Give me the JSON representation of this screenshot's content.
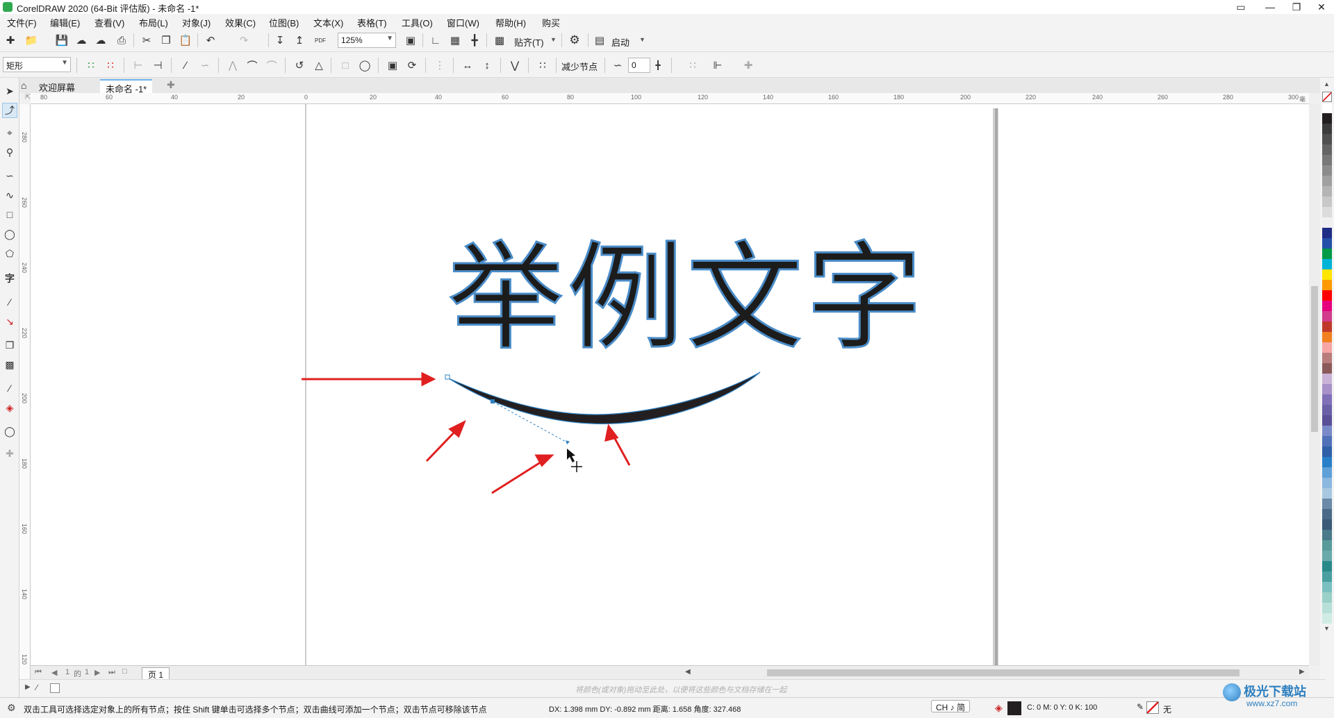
{
  "window": {
    "title": "CorelDRAW 2020 (64-Bit 评估版) - 未命名 -1*",
    "buttons": [
      "minimize",
      "maximize",
      "close"
    ]
  },
  "menu": [
    "文件(F)",
    "编辑(E)",
    "查看(V)",
    "布局(L)",
    "对象(J)",
    "效果(C)",
    "位图(B)",
    "文本(X)",
    "表格(T)",
    "工具(O)",
    "窗口(W)",
    "帮助(H)",
    "购买"
  ],
  "toolbar1": {
    "zoom_value": "125%",
    "snap_label": "贴齐(T)",
    "launch_label": "启动",
    "pdf_label": "PDF"
  },
  "toolbar2": {
    "shape_type": "矩形",
    "reduce_nodes_label": "减少节点",
    "smoothness_value": "0"
  },
  "tabs": {
    "welcome": "欢迎屏幕",
    "document": "未命名 -1*"
  },
  "ruler": {
    "h_labels": [
      "80",
      "60",
      "40",
      "20",
      "0",
      "20",
      "40",
      "60",
      "80",
      "100",
      "120",
      "140",
      "160",
      "180",
      "200",
      "220",
      "240",
      "260",
      "280",
      "300"
    ],
    "v_labels": [
      "280",
      "260",
      "240",
      "220",
      "200",
      "180",
      "160",
      "140",
      "120"
    ],
    "unit": "毫米"
  },
  "canvas": {
    "artwork_text": "举例文字"
  },
  "pagebar": {
    "page_current": "1",
    "page_sep": "的",
    "page_total": "1",
    "page_tab": "页 1"
  },
  "colorbar": {
    "hint": "将颜色(或对象)拖动至此处，以便将这些颜色与文档存储在一起"
  },
  "status": {
    "hint": "双击工具可选择选定对象上的所有节点；按住 Shift 键单击可选择多个节点；双击曲线可添加一个节点；双击节点可移除该节点",
    "measure": "DX:  1.398 mm DY:  -0.892 mm 距离:  1.658 角度:  327.468",
    "ime": "CH ♪ 简",
    "fill_readout": "C: 0 M: 0 Y: 0 K: 100",
    "outline_none": "无"
  },
  "watermark": {
    "brand": "极光下载站",
    "url": "www.xz7.com"
  },
  "palette_colors": [
    "#ffffff",
    "#231f20",
    "#3c3c3c",
    "#505050",
    "#646464",
    "#787878",
    "#8c8c8c",
    "#a0a0a0",
    "#b4b4b4",
    "#c8c8c8",
    "#dcdcdc",
    "#f0f0f0",
    "#1f2d86",
    "#2550a8",
    "#009a49",
    "#00b4d8",
    "#ffe600",
    "#ff9a00",
    "#ff0000",
    "#e6007e",
    "#d23c8c",
    "#c03a2b",
    "#f08020",
    "#f7a5a5",
    "#b87c7c",
    "#8a5a5a",
    "#c9b3d6",
    "#a890c8",
    "#8070b8",
    "#6a60a8",
    "#5a5098",
    "#7a8ac8",
    "#5070b8",
    "#3060a8",
    "#2a80c8",
    "#60a0d8",
    "#8cb8e0",
    "#a8c8e0",
    "#6a8aa8",
    "#4a6a88",
    "#3a5a78",
    "#4a7a8a",
    "#5a9a9a",
    "#6aaaaa",
    "#2a8a8a",
    "#4aa0a0",
    "#7ac0c0",
    "#9ad0c8",
    "#b8e0d8",
    "#d0ece4"
  ],
  "colors": {
    "accent": "#2f80c0",
    "arrow_red": "#e02020",
    "node_blue": "#2f80c0",
    "ink": "#231f20"
  }
}
